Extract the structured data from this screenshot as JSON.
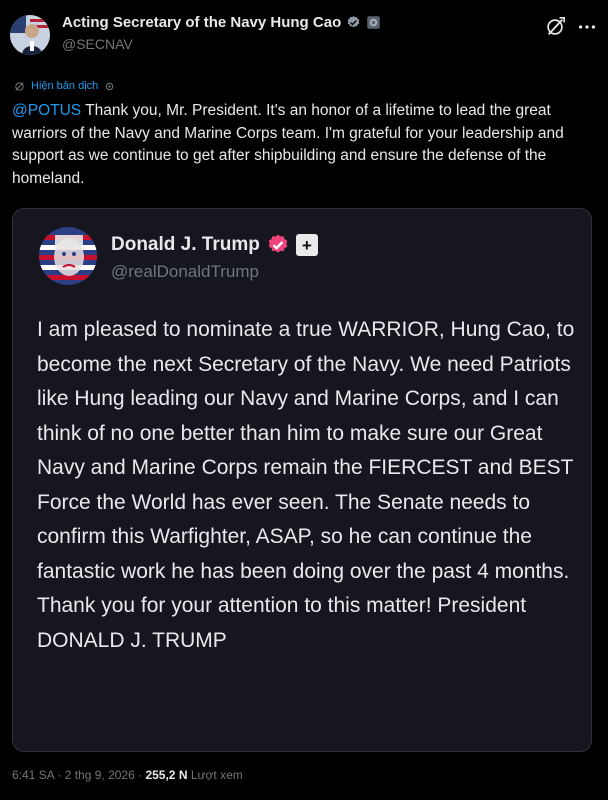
{
  "header": {
    "display_name": "Acting Secretary of the Navy Hung Cao",
    "handle": "@SECNAV"
  },
  "translate": {
    "label": "Hiện bản dịch"
  },
  "post": {
    "mention": "@POTUS",
    "text": " Thank you, Mr. President.  It's an honor of a lifetime to lead the great warriors of the Navy and Marine Corps team.  I'm grateful for your leadership and support as we continue to get after shipbuilding and ensure the defense of the homeland."
  },
  "quote": {
    "display_name": "Donald J. Trump",
    "handle": "@realDonaldTrump",
    "plus_label": "+",
    "text": "I am pleased to nominate a true WARRIOR, Hung Cao, to become the next Secretary of the Navy. We need Patriots like Hung leading our Navy and Marine Corps, and I can think of no one better than him to make sure our Great Navy and Marine Corps remain the FIERCEST and BEST Force the World has ever seen. The Senate needs to confirm this Warfighter, ASAP, so he can continue the fantastic work he has been doing over the past 4 months. Thank you for your attention to this matter! President DONALD J. TRUMP"
  },
  "meta": {
    "time": "6:41 SA",
    "separator": " · ",
    "date": "2 thg 9, 2026",
    "views_count": "255,2 N",
    "views_label": " Lượt xem"
  },
  "icons": {
    "verified_gray": "verified-gray-icon",
    "verified_gold": "verified-gold-icon",
    "grok": "grok-icon",
    "more": "more-icon",
    "translate": "translate-icon",
    "gear": "gear-icon"
  },
  "colors": {
    "link": "#1d9bf0",
    "secondary_text": "#71767b",
    "primary_text": "#e7e9ea",
    "quote_border": "#2f3336"
  }
}
